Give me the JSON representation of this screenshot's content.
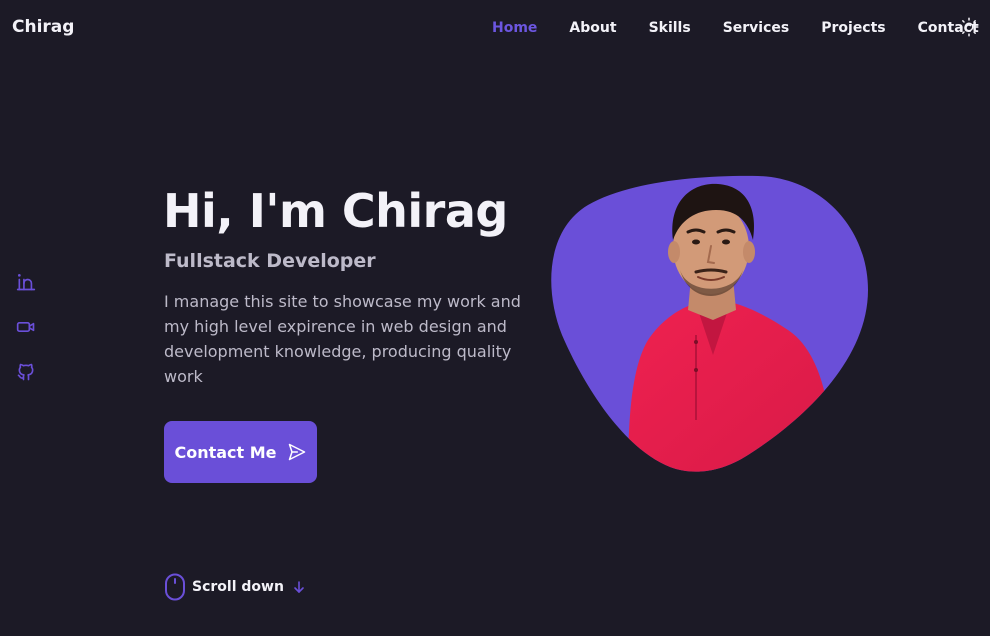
{
  "header": {
    "logo": "Chirag",
    "nav": [
      {
        "label": "Home",
        "active": true
      },
      {
        "label": "About",
        "active": false
      },
      {
        "label": "Skills",
        "active": false
      },
      {
        "label": "Services",
        "active": false
      },
      {
        "label": "Projects",
        "active": false
      },
      {
        "label": "Contact",
        "active": false
      }
    ],
    "theme_icon": "sun-icon"
  },
  "social": [
    {
      "icon": "linkedin-icon"
    },
    {
      "icon": "video-icon"
    },
    {
      "icon": "github-icon"
    }
  ],
  "hero": {
    "title": "Hi, I'm Chirag",
    "subtitle": "Fullstack Developer",
    "description": "I manage this site to showcase my work and my high level expirence in web design and development knowledge, producing quality work",
    "button_label": "Contact Me",
    "button_icon": "send-icon"
  },
  "scroll": {
    "label": "Scroll down",
    "mouse_icon": "mouse-icon",
    "arrow_icon": "arrow-down-icon"
  },
  "colors": {
    "background": "#1c1a26",
    "accent": "#6a4fd8",
    "text": "#f3f2f8",
    "muted": "#bdbac9"
  }
}
